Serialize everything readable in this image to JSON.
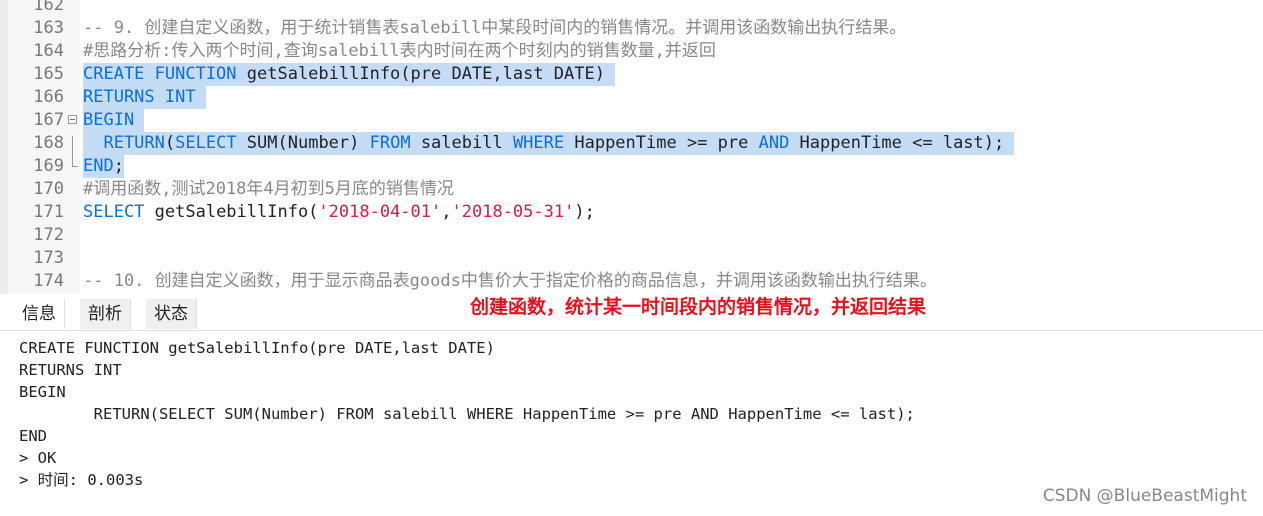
{
  "editor": {
    "lines": [
      {
        "n": "162",
        "parts": []
      },
      {
        "n": "163",
        "parts": [
          {
            "t": "-- 9. 创建自定义函数，用于统计销售表salebill中某段时间内的销售情况。并调用该函数输出执行结果。",
            "c": "cm"
          }
        ]
      },
      {
        "n": "164",
        "parts": [
          {
            "t": "#思路分析:传入两个时间,查询salebill表内时间在两个时刻内的销售数量,并返回",
            "c": "cm"
          }
        ]
      },
      {
        "n": "165",
        "sel": true,
        "parts": [
          {
            "t": "CREATE FUNCTION ",
            "c": "kw"
          },
          {
            "t": "getSalebillInfo(pre DATE,last DATE) ",
            "c": "id"
          }
        ]
      },
      {
        "n": "166",
        "sel": true,
        "parts": [
          {
            "t": "RETURNS INT ",
            "c": "kw"
          }
        ]
      },
      {
        "n": "167",
        "sel": true,
        "parts": [
          {
            "t": "BEGIN ",
            "c": "kw"
          }
        ]
      },
      {
        "n": "168",
        "sel": true,
        "parts": [
          {
            "t": "  RETURN",
            "c": "kw"
          },
          {
            "t": "(",
            "c": "id"
          },
          {
            "t": "SELECT ",
            "c": "kw"
          },
          {
            "t": "SUM(Number) ",
            "c": "id"
          },
          {
            "t": "FROM ",
            "c": "kw"
          },
          {
            "t": "salebill ",
            "c": "id"
          },
          {
            "t": "WHERE ",
            "c": "kw"
          },
          {
            "t": "HappenTime >= pre ",
            "c": "id"
          },
          {
            "t": "AND ",
            "c": "kw"
          },
          {
            "t": "HappenTime <= last); ",
            "c": "id"
          }
        ]
      },
      {
        "n": "169",
        "sel": true,
        "parts": [
          {
            "t": "END",
            "c": "kw"
          },
          {
            "t": ";",
            "c": "id"
          }
        ]
      },
      {
        "n": "170",
        "parts": [
          {
            "t": "#调用函数,测试2018年4月初到5月底的销售情况",
            "c": "cm"
          }
        ]
      },
      {
        "n": "171",
        "parts": [
          {
            "t": "SELECT ",
            "c": "kw"
          },
          {
            "t": "getSalebillInfo(",
            "c": "id"
          },
          {
            "t": "'2018-04-01'",
            "c": "str"
          },
          {
            "t": ",",
            "c": "id"
          },
          {
            "t": "'2018-05-31'",
            "c": "str"
          },
          {
            "t": ");",
            "c": "id"
          }
        ]
      },
      {
        "n": "172",
        "parts": []
      },
      {
        "n": "173",
        "parts": []
      },
      {
        "n": "174",
        "parts": [
          {
            "t": "-- 10. 创建自定义函数，用于显示商品表goods中售价大于指定价格的商品信息，并调用该函数输出执行结果。",
            "c": "cm"
          }
        ]
      }
    ]
  },
  "tabs": [
    "信息",
    "剖析",
    "状态"
  ],
  "annotation": "创建函数，统计某一时间段内的销售情况，并返回结果",
  "output": [
    "CREATE FUNCTION getSalebillInfo(pre DATE,last DATE)",
    "RETURNS INT",
    "BEGIN",
    "        RETURN(SELECT SUM(Number) FROM salebill WHERE HappenTime >= pre AND HappenTime <= last);",
    "END",
    "> OK",
    "> 时间: 0.003s"
  ],
  "watermark": "CSDN @BlueBeastMight",
  "colors": {
    "keyword": "#0a6edb",
    "string": "#e0183c",
    "comment": "#888888",
    "selection": "#c5dcf7",
    "annotation": "#e8101c"
  }
}
